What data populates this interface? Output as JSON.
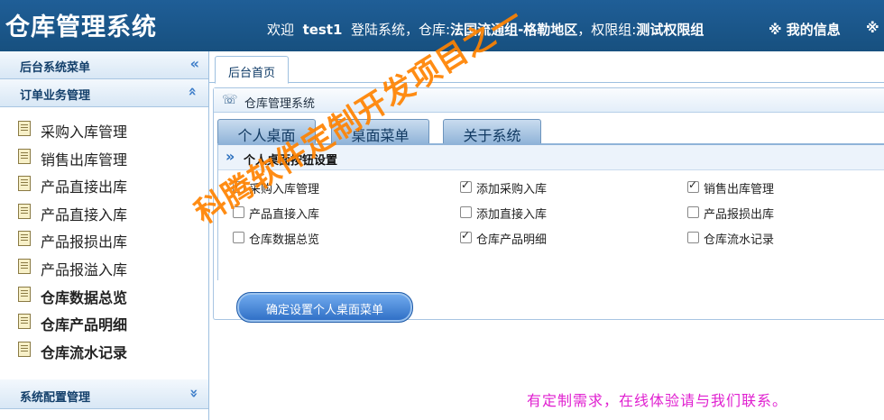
{
  "header": {
    "app_title": "仓库管理系统",
    "welcome_prefix": "欢迎",
    "username": "test1",
    "login_text": "登陆系统，仓库:",
    "warehouse": "法国流通组-格勒地区",
    "perm_prefix": "，权限组:",
    "perm_group": "测试权限组",
    "my_info": "※ 我的信息",
    "extra_mark": "※"
  },
  "sidebar": {
    "backend_menu": "后台系统菜单",
    "order_group": "订单业务管理",
    "items": [
      {
        "label": "采购入库管理",
        "bold": false
      },
      {
        "label": "销售出库管理",
        "bold": false
      },
      {
        "label": "产品直接出库",
        "bold": false
      },
      {
        "label": "产品直接入库",
        "bold": false
      },
      {
        "label": "产品报损出库",
        "bold": false
      },
      {
        "label": "产品报溢入库",
        "bold": false
      },
      {
        "label": "仓库数据总览",
        "bold": true
      },
      {
        "label": "仓库产品明细",
        "bold": true
      },
      {
        "label": "仓库流水记录",
        "bold": true
      }
    ],
    "system_config": "系统配置管理",
    "icons": {
      "collapse": "double-chevron-left-icon",
      "group_toggle": "double-chevron-up-icon",
      "config_toggle": "double-chevron-down-icon",
      "item": "document-icon"
    }
  },
  "main": {
    "tab_home": "后台首页",
    "panel_title": "仓库管理系统",
    "subtabs": [
      "个人桌面",
      "桌面菜单",
      "关于系统"
    ],
    "settings_title": "个人桌面按钮设置",
    "checkboxes": [
      {
        "label": "采购入库管理",
        "checked": true
      },
      {
        "label": "添加采购入库",
        "checked": true
      },
      {
        "label": "销售出库管理",
        "checked": true
      },
      {
        "label": "产品直接入库",
        "checked": false
      },
      {
        "label": "添加直接入库",
        "checked": false
      },
      {
        "label": "产品报损出库",
        "checked": false
      },
      {
        "label": "仓库数据总览",
        "checked": false
      },
      {
        "label": "仓库产品明细",
        "checked": true
      },
      {
        "label": "仓库流水记录",
        "checked": false
      }
    ],
    "confirm_button": "确定设置个人桌面菜单"
  },
  "overlay": {
    "watermark": "科腾软件定制开发项目之一",
    "promo": "有定制需求，在线体验请与我们联系。"
  },
  "colors": {
    "header_bg": "#1f5e97",
    "watermark": "#ff8200",
    "promo": "#e020d0"
  }
}
